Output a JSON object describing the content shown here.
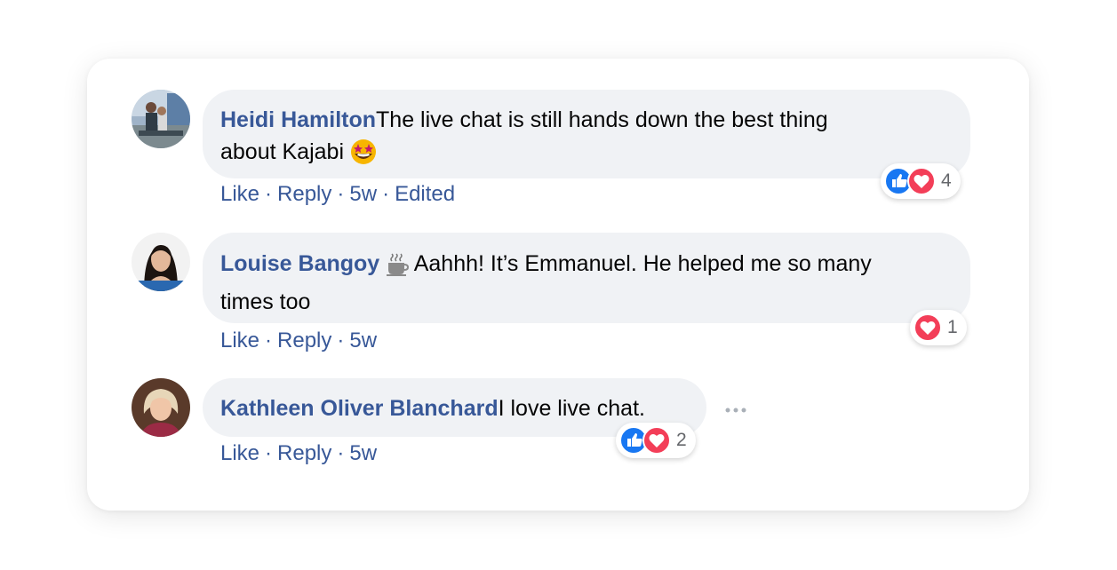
{
  "comments": [
    {
      "author": "Heidi Hamilton",
      "text_line1": "The live chat is still hands down the best thing",
      "text_line2": "about Kajabi",
      "emoji": "star-struck-emoji",
      "actions": {
        "like": "Like",
        "reply": "Reply",
        "time": "5w",
        "edited": "Edited"
      },
      "reactions": {
        "icons": [
          "like-reaction-icon",
          "love-reaction-icon"
        ],
        "count": "4"
      }
    },
    {
      "author": "Louise Bangoy",
      "author_badge": "coffee-icon",
      "text_line1": "Aahhh! It’s Emmanuel. He helped me so many",
      "text_line2": "times too",
      "actions": {
        "like": "Like",
        "reply": "Reply",
        "time": "5w"
      },
      "reactions": {
        "icons": [
          "love-reaction-icon"
        ],
        "count": "1"
      }
    },
    {
      "author": "Kathleen Oliver Blanchard",
      "text_line1": "I love live chat.",
      "actions": {
        "like": "Like",
        "reply": "Reply",
        "time": "5w"
      },
      "reactions": {
        "icons": [
          "like-reaction-icon",
          "love-reaction-icon"
        ],
        "count": "2"
      },
      "options_icon": "more-options-icon"
    }
  ],
  "colors": {
    "author": "#385898",
    "bubble": "#f0f2f5",
    "like_blue": "#1877f2",
    "love_red": "#f33e58"
  },
  "separator": "·"
}
